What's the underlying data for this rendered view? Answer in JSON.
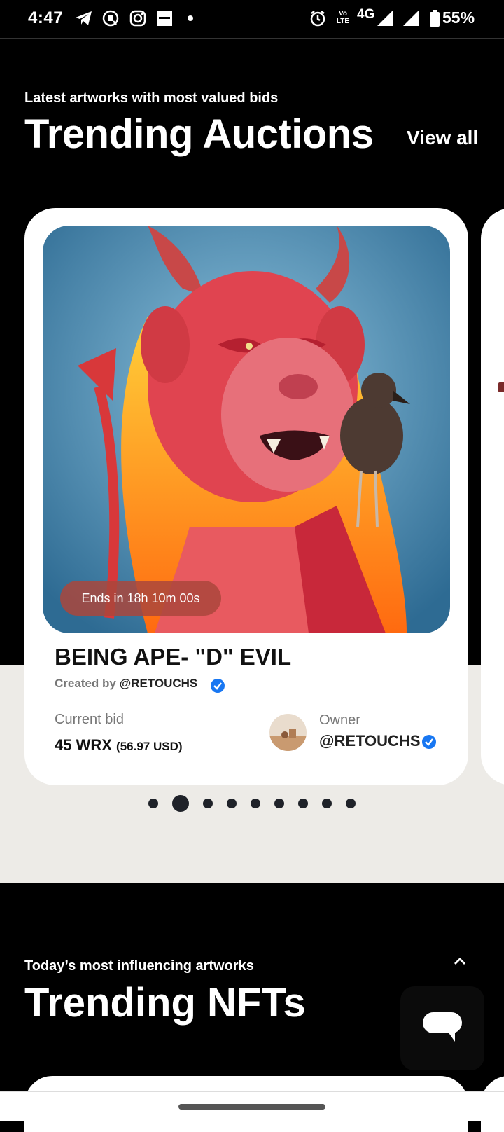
{
  "status_bar": {
    "time": "4:47",
    "network": "4G",
    "volte": "Vo LTE",
    "battery": "55%",
    "icons": [
      "telegram-icon",
      "message-icon",
      "instagram-icon",
      "envato-icon",
      "dot-icon",
      "alarm-icon",
      "volte-icon",
      "signal-icon",
      "signal-icon-2",
      "battery-icon"
    ]
  },
  "trending_auctions": {
    "subtitle": "Latest artworks with most valued bids",
    "title": "Trending Auctions",
    "view_all": "View all",
    "card": {
      "timer": "Ends in 18h 10m 00s",
      "artwork_title": "BEING APE- \"D\" EVIL",
      "created_by_label": "Created by",
      "creator": "@RETOUCHS",
      "current_bid_label": "Current bid",
      "current_bid_value": "45 WRX",
      "current_bid_usd": "(56.97 USD)",
      "owner_label": "Owner",
      "owner": "@RETOUCHS"
    },
    "pagination": {
      "total": 9,
      "active_index": 1
    }
  },
  "trending_nfts": {
    "subtitle": "Today’s most influencing artworks",
    "title": "Trending NFTs"
  },
  "colors": {
    "background": "#000000",
    "card": "#ffffff",
    "band": "#edebe7",
    "verified": "#1877f2",
    "dot": "#1f2229"
  }
}
